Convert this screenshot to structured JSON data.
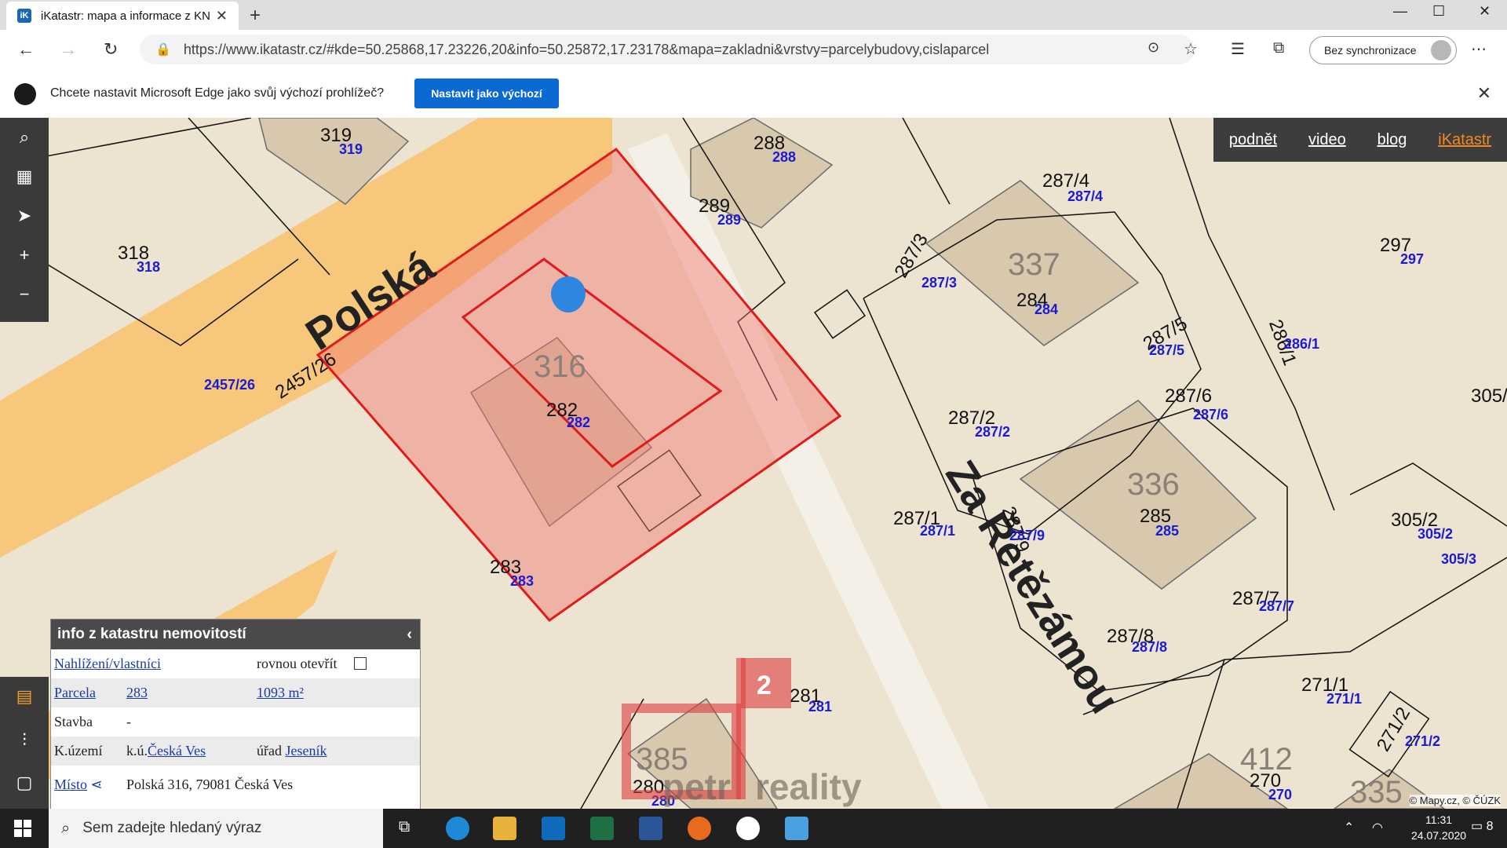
{
  "browser": {
    "tab_title": "iKatastr: mapa a informace z KN",
    "url": "https://www.ikatastr.cz/#kde=50.25868,17.23226,20&info=50.25872,17.23178&mapa=zakladni&vrstvy=parcelybudovy,cislaparcel",
    "sync_label": "Bez synchronizace",
    "infobar_message": "Chcete nastavit Microsoft Edge jako svůj výchozí prohlížeč?",
    "infobar_button": "Nastavit jako výchozí"
  },
  "top_links": [
    "podnět",
    "video",
    "blog",
    "iKatastr"
  ],
  "map": {
    "street_1": "Polská",
    "street_2": "Za Řetězámou",
    "building_numbers": [
      "319",
      "288",
      "337",
      "316",
      "336",
      "297",
      "385",
      "412",
      "335"
    ],
    "parcel_labels": [
      "319",
      "318",
      "288",
      "289",
      "287/4",
      "287/3",
      "284",
      "287/5",
      "286/1",
      "287/2",
      "287/6",
      "282",
      "283",
      "287/1",
      "285",
      "287/9",
      "305/2",
      "305/3",
      "305/",
      "287/7",
      "287/8",
      "281",
      "271/1",
      "271/2",
      "280",
      "270",
      "2457/26",
      "297",
      "2457/26"
    ],
    "watermark_digit": "2",
    "watermark_text_1": "petr",
    "watermark_text_2": "reality",
    "attribution": "© Mapy.cz, © ČÚZK"
  },
  "panel": {
    "title": "info z katastru nemovitostí",
    "row1_link": "Nahlížení/vlastníci",
    "row1_check_label": "rovnou otevřít",
    "row2_label": "Parcela",
    "row2_value": "283",
    "row2_area": "1093 m²",
    "row3_label": "Stavba",
    "row3_value": "-",
    "row4_label": "K.území",
    "row4_prefix": "k.ú.",
    "row4_value": "Česká Ves",
    "row4_office_label": "úřad",
    "row4_office": "Jeseník",
    "row5_label": "Místo",
    "row5_value": "Polská 316, 79081 Česká Ves"
  },
  "taskbar": {
    "search_placeholder": "Sem zadejte hledaný výraz",
    "time": "11:31",
    "date": "24.07.2020",
    "notifications": "8"
  }
}
